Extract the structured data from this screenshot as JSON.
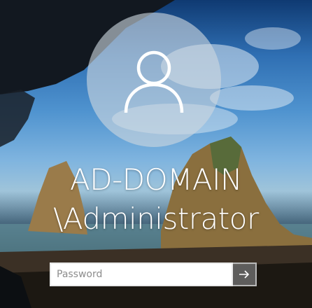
{
  "login": {
    "user_line1": "AD-DOMAIN",
    "user_line2": "\\Administrator",
    "password_placeholder": "Password"
  },
  "icons": {
    "avatar": "user-avatar-icon",
    "submit": "right-arrow-icon"
  },
  "colors": {
    "text": "#ffffff",
    "avatar_bg": "#cdd6de",
    "input_bg": "#ffffff",
    "submit_bg": "#787878"
  }
}
